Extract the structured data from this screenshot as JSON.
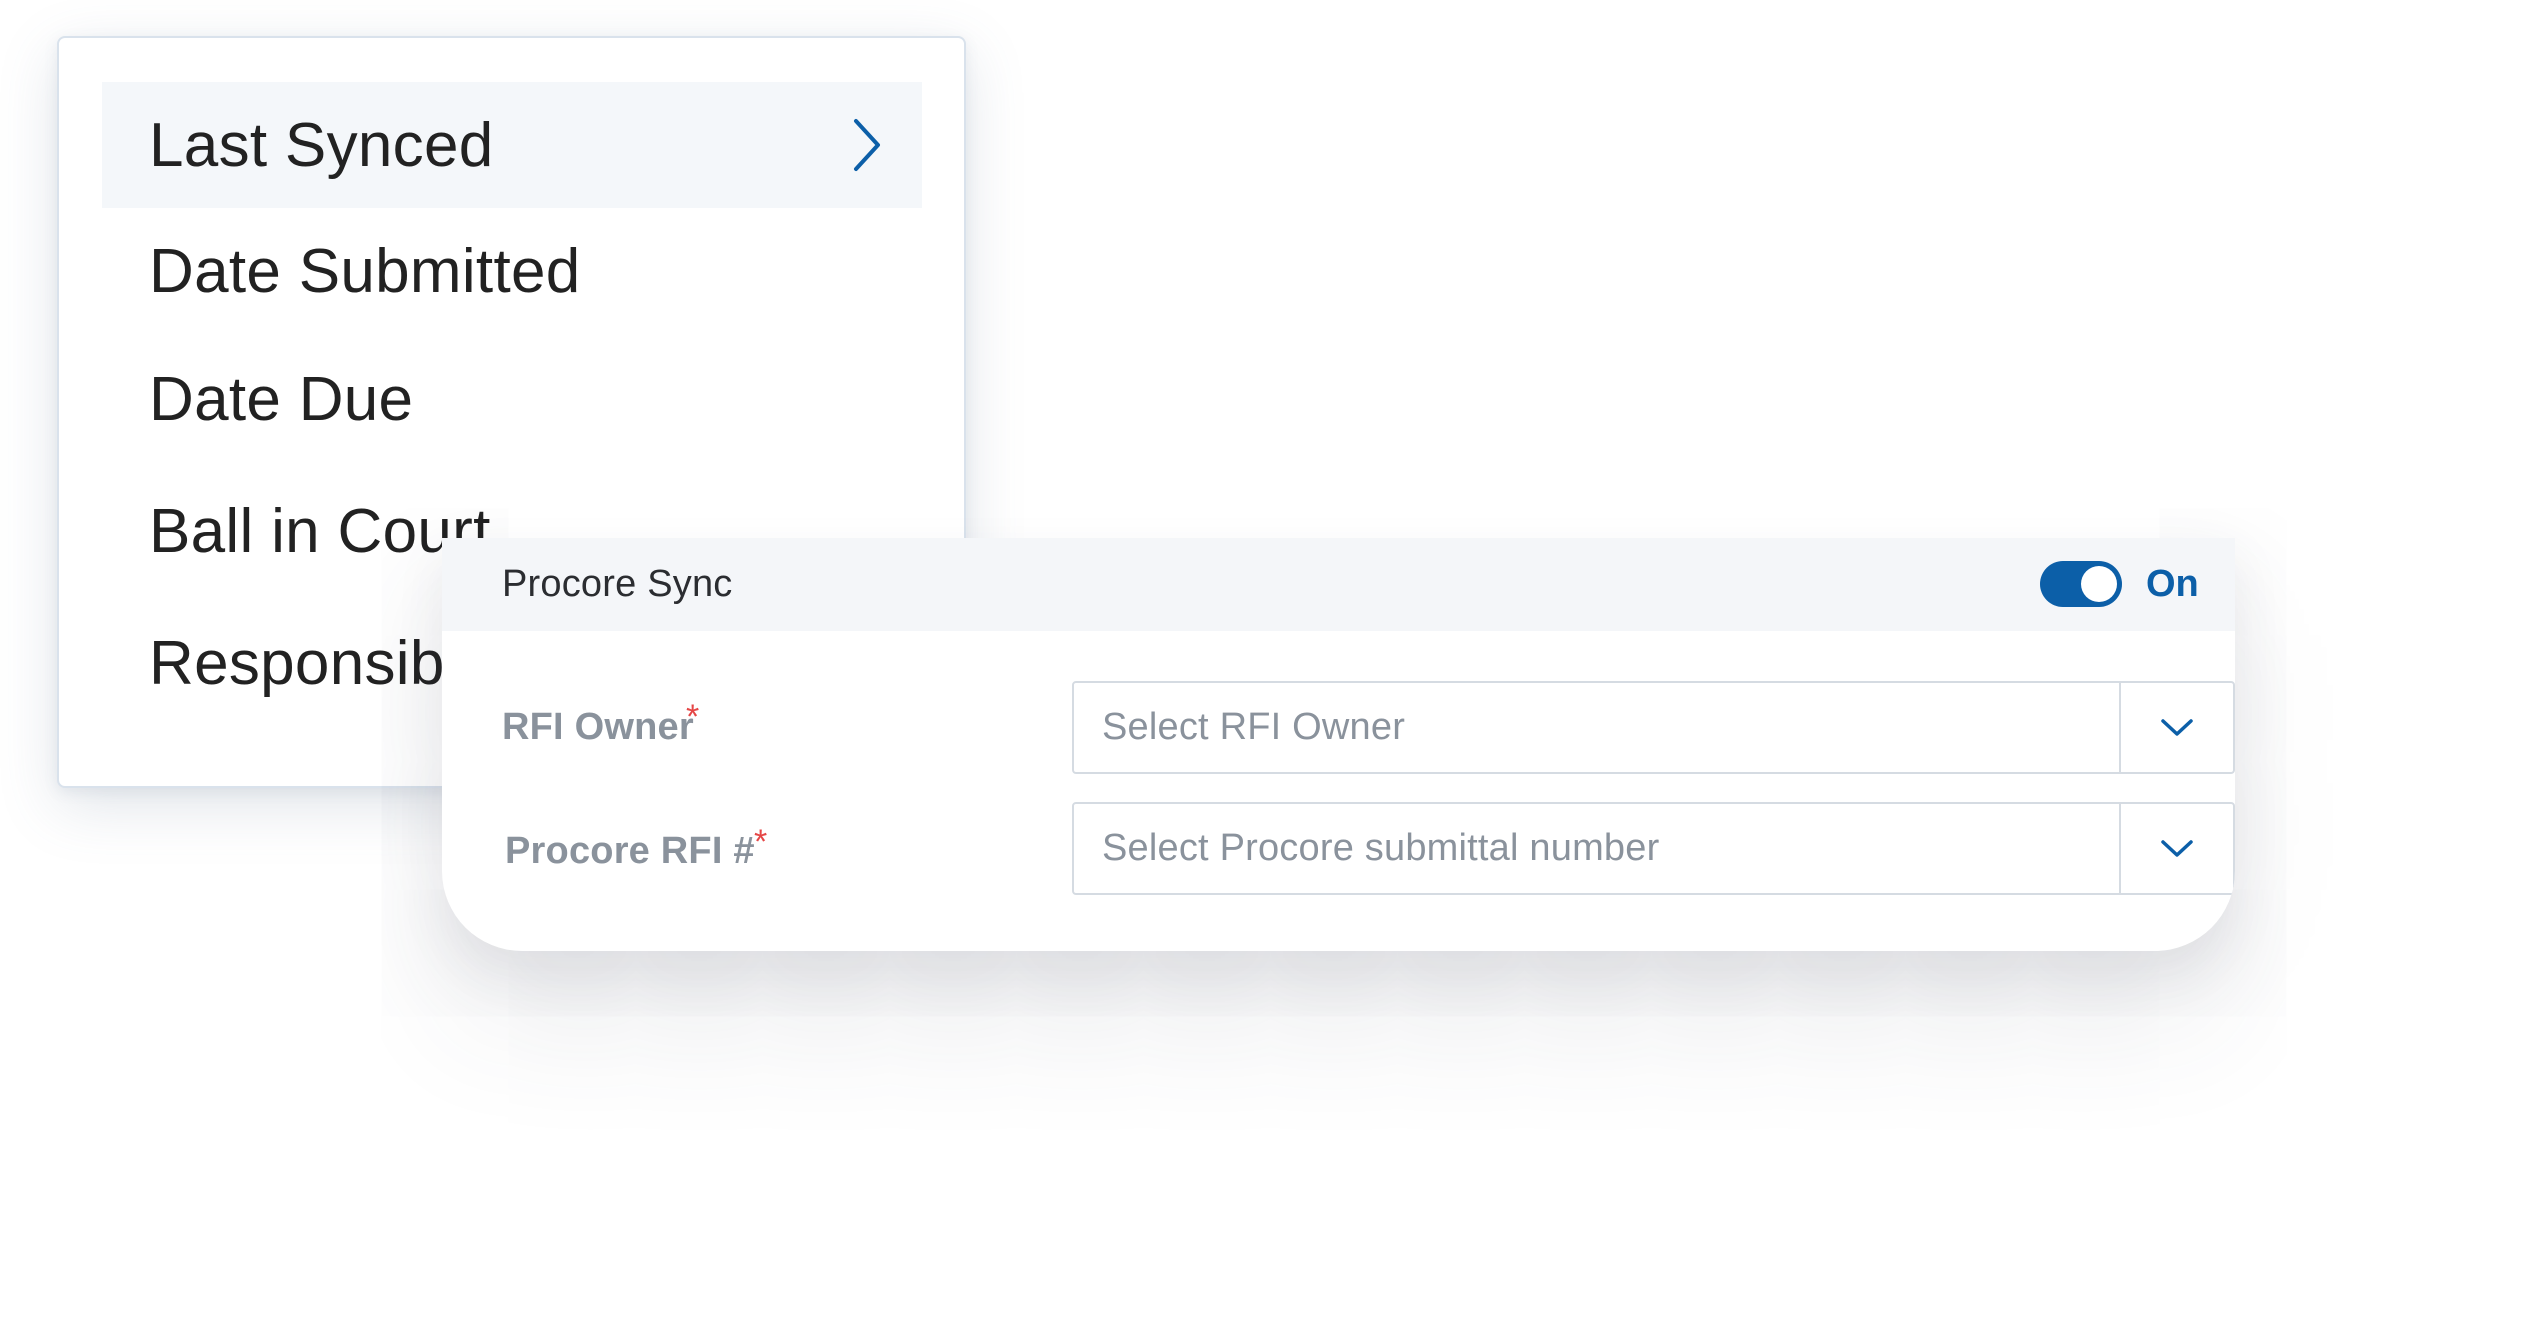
{
  "menu": {
    "items": [
      {
        "label": "Last Synced",
        "active": true
      },
      {
        "label": "Date Submitted",
        "active": false
      },
      {
        "label": "Date Due",
        "active": false
      },
      {
        "label": "Ball in Court",
        "active": false
      },
      {
        "label": "Responsible",
        "active": false
      }
    ],
    "active_chevron_icon": "chevron-right-icon"
  },
  "sync_panel": {
    "title": "Procore Sync",
    "toggle": {
      "state": "on",
      "label": "On"
    },
    "fields": [
      {
        "label": "RFI Owner",
        "required_marker": "*",
        "placeholder": "Select RFI Owner",
        "caret_icon": "chevron-down-icon"
      },
      {
        "label": "Procore RFI #",
        "required_marker": "*",
        "placeholder": "Select Procore submittal number",
        "caret_icon": "chevron-down-icon"
      }
    ]
  },
  "colors": {
    "accent": "#0c5fa8",
    "required": "#e54646",
    "muted_text": "#8a929c",
    "menu_text": "#222222",
    "active_row_bg": "#f4f7fa",
    "header_bg": "#f4f6f9"
  }
}
